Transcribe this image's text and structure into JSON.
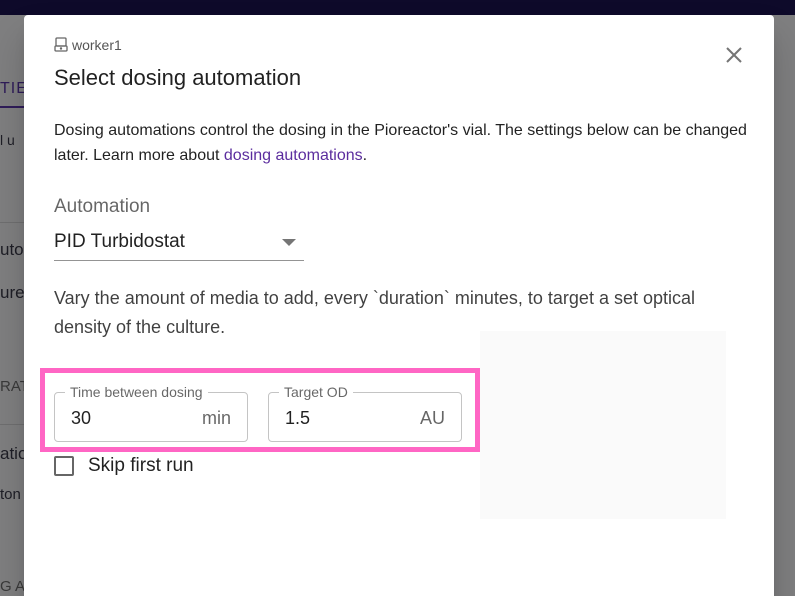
{
  "background": {
    "tab_label": "TIES",
    "fragments": [
      "l u",
      "uto",
      "ure",
      "RAT",
      "atio",
      "ton",
      "G A"
    ]
  },
  "dialog": {
    "worker_name": "worker1",
    "title": "Select dosing automation",
    "close_icon": "close-icon",
    "description_text": "Dosing automations control the dosing in the Pioreactor's vial. The settings below can be changed later. Learn more about ",
    "description_link": "dosing automations",
    "description_end": ".",
    "automation_label": "Automation",
    "automation_selected": "PID Turbidostat",
    "automation_description": "Vary the amount of media to add, every `duration` minutes, to target a set optical density of the culture.",
    "fields": [
      {
        "label": "Time between dosing",
        "value": "30",
        "unit": "min"
      },
      {
        "label": "Target OD",
        "value": "1.5",
        "unit": "AU"
      }
    ],
    "checkbox_label": "Skip first run",
    "checkbox_checked": false
  },
  "colors": {
    "highlight": "#ff66c4",
    "link": "#5b2d9e",
    "topbar": "#0e0a2a"
  }
}
